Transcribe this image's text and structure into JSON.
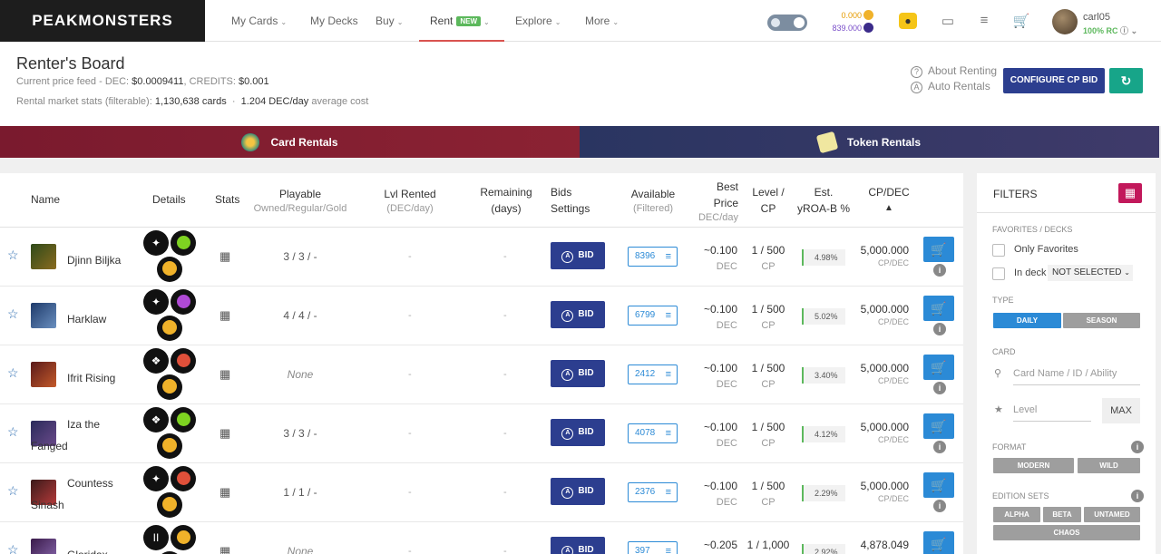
{
  "nav": {
    "logo_text": "PEAKMONSTERS",
    "items": [
      "My Cards",
      "My Decks",
      "Buy",
      "Rent",
      "Explore",
      "More"
    ],
    "rent_badge": "NEW",
    "dec_balance": "0.000",
    "credits_balance": "839.000",
    "username": "carl05",
    "rc": "100% RC"
  },
  "header": {
    "title": "Renter's Board",
    "price_feed_prefix": "Current price feed - DEC:",
    "dec_price": "$0.0009411",
    "credits_label": ", CREDITS:",
    "credits_price": "$0.001",
    "stats_prefix": "Rental market stats (filterable):",
    "cards_count": "1,130,638 cards",
    "sep": "·",
    "avg_dec": "1.204 DEC/day",
    "avg_label": "average cost",
    "about_renting": "About Renting",
    "auto_rentals": "Auto Rentals",
    "configure_btn": "CONFIGURE CP BID",
    "refresh_icon": "C"
  },
  "tabs": {
    "card_rentals": "Card Rentals",
    "token_rentals": "Token Rentals"
  },
  "table": {
    "headers": {
      "name": "Name",
      "details": "Details",
      "stats": "Stats",
      "playable": "Playable",
      "playable_sub": "Owned/Regular/Gold",
      "lvl_rented": "Lvl Rented",
      "lvl_rented_sub": "(DEC/day)",
      "remaining": "Remaining",
      "remaining_sub": "(days)",
      "bids": "Bids",
      "bids_sub": "Settings",
      "available": "Available",
      "available_sub": "(Filtered)",
      "best": "Best",
      "best_price": "Price",
      "best_sub": "DEC/day",
      "level": "Level /",
      "level_sub": "CP",
      "est": "Est.",
      "yroa": "yROA-B %",
      "cpdec": "CP/DEC",
      "sort_icon": "^"
    },
    "rows": [
      {
        "name": "Djinn Biljka",
        "playable": "3 / 3 / -",
        "rented": "-",
        "remaining": "-",
        "bid": "BID",
        "available": "8396",
        "price": "~0.100",
        "price_unit": "DEC",
        "level": "1 / 500",
        "level_unit": "CP",
        "yroa": "4.98%",
        "cpdec": "5,000.000",
        "cpdec_unit": "CP/DEC"
      },
      {
        "name": "Harklaw",
        "playable": "4 / 4 / -",
        "rented": "-",
        "remaining": "-",
        "bid": "BID",
        "available": "6799",
        "price": "~0.100",
        "price_unit": "DEC",
        "level": "1 / 500",
        "level_unit": "CP",
        "yroa": "5.02%",
        "cpdec": "5,000.000",
        "cpdec_unit": "CP/DEC"
      },
      {
        "name": "Ifrit Rising",
        "playable": "None",
        "rented": "-",
        "remaining": "-",
        "bid": "BID",
        "available": "2412",
        "price": "~0.100",
        "price_unit": "DEC",
        "level": "1 / 500",
        "level_unit": "CP",
        "yroa": "3.40%",
        "cpdec": "5,000.000",
        "cpdec_unit": "CP/DEC"
      },
      {
        "name": "Iza the Fanged",
        "playable": "3 / 3 / -",
        "rented": "-",
        "remaining": "-",
        "bid": "BID",
        "available": "4078",
        "price": "~0.100",
        "price_unit": "DEC",
        "level": "1 / 500",
        "level_unit": "CP",
        "yroa": "4.12%",
        "cpdec": "5,000.000",
        "cpdec_unit": "CP/DEC"
      },
      {
        "name": "Countess Sinash",
        "playable": "1 / 1 / -",
        "rented": "-",
        "remaining": "-",
        "bid": "BID",
        "available": "2376",
        "price": "~0.100",
        "price_unit": "DEC",
        "level": "1 / 500",
        "level_unit": "CP",
        "yroa": "2.29%",
        "cpdec": "5,000.000",
        "cpdec_unit": "CP/DEC"
      },
      {
        "name": "Gloridax",
        "playable": "None",
        "rented": "-",
        "remaining": "-",
        "bid": "BID",
        "available": "397",
        "price": "~0.205",
        "price_unit": "DEC",
        "level": "1 / 1,000",
        "level_unit": "CP",
        "yroa": "2.92%",
        "cpdec": "4,878.049",
        "cpdec_unit": "CP/DEC"
      }
    ]
  },
  "filters": {
    "title": "FILTERS",
    "favorites_label": "FAVORITES / DECKS",
    "only_favorites": "Only Favorites",
    "in_deck": "In deck",
    "deck_select": "NOT SELECTED",
    "type_label": "TYPE",
    "type_daily": "DAILY",
    "type_season": "SEASON",
    "card_label": "CARD",
    "card_placeholder": "Card Name / ID / Ability",
    "level_placeholder": "Level",
    "max_btn": "MAX",
    "format_label": "FORMAT",
    "format_modern": "MODERN",
    "format_wild": "WILD",
    "edition_label": "EDITION SETS",
    "editions": [
      "ALPHA",
      "BETA",
      "UNTAMED",
      "CHAOS"
    ]
  },
  "colors": {
    "primary_blue": "#2c3e8f",
    "accent_blue": "#2b8ad6",
    "card_rentals_tab": "#7a1a2e",
    "token_rentals_tab": "#2a3561",
    "filter_button": "#c2185b",
    "refresh_button": "#17a589"
  }
}
